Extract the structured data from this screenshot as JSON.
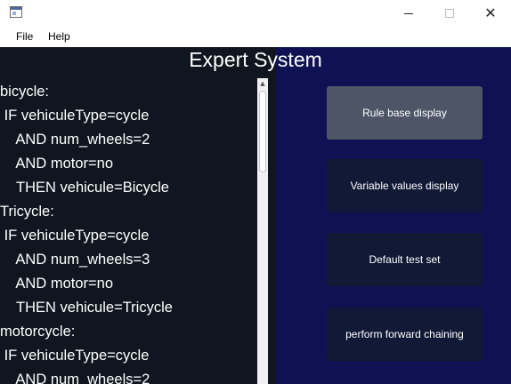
{
  "menu": {
    "file": "File",
    "help": "Help"
  },
  "window": {
    "close_glyph": "✕"
  },
  "app": {
    "title": "Expert System"
  },
  "rules": [
    "bicycle:",
    " IF vehiculeType=cycle",
    "    AND num_wheels=2",
    "    AND motor=no",
    "    THEN vehicule=Bicycle",
    "Tricycle:",
    " IF vehiculeType=cycle",
    "    AND num_wheels=3",
    "    AND motor=no",
    "    THEN vehicule=Tricycle",
    "motorcycle:",
    " IF vehiculeType=cycle",
    "    AND num_wheels=2"
  ],
  "buttons": {
    "rule_base_display": "Rule base display",
    "variable_values_display": "Variable values display",
    "default_test_set": "Default test set",
    "forward_chaining": "perform forward chaining"
  },
  "colors": {
    "background": "#0e1252",
    "rules_panel": "#0f1620",
    "button": "#101936",
    "button_active": "#4d5566"
  },
  "icons": [
    "app-icon",
    "minimize-icon",
    "maximize-icon",
    "close-icon",
    "scroll-up-arrow-icon"
  ]
}
